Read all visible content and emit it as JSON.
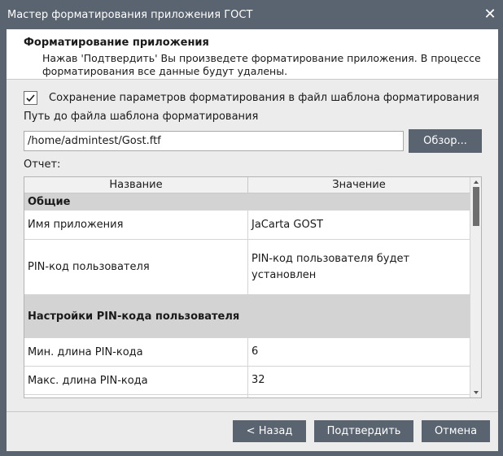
{
  "window": {
    "title": "Мастер форматирования приложения ГОСТ",
    "close_glyph": "✕"
  },
  "header": {
    "title": "Форматирование приложения",
    "description": "Нажав 'Подтвердить' Вы произведете форматирование приложения. В процессе форматирования все данные будут удалены."
  },
  "options": {
    "save_template_checked": true,
    "save_template_label": "Сохранение параметров форматирования в файл шаблона форматирования",
    "path_label": "Путь до файла шаблона форматирования",
    "path_value": "/home/admintest/Gost.ftf",
    "browse_label": "Обзор..."
  },
  "report": {
    "label": "Отчет:",
    "columns": [
      "Название",
      "Значение"
    ],
    "rows": [
      {
        "type": "section",
        "name": "Общие"
      },
      {
        "type": "item",
        "name": "Имя приложения",
        "value": "JaCarta GOST"
      },
      {
        "type": "item",
        "name": "PIN-код пользователя",
        "value": "PIN-код пользователя будет установлен"
      },
      {
        "type": "section",
        "name": "Настройки PIN-кода пользователя"
      },
      {
        "type": "item",
        "name": "Мин. длина PIN-кода",
        "value": "6"
      },
      {
        "type": "item",
        "name": "Макс. длина PIN-кода",
        "value": "32"
      },
      {
        "type": "item",
        "name": "",
        "value": ""
      }
    ]
  },
  "footer": {
    "back_label": "< Назад",
    "confirm_label": "Подтвердить",
    "cancel_label": "Отмена"
  },
  "colors": {
    "accent": "#5a6370",
    "section_row": "#d3d3d3",
    "dialog_bg": "#ececec"
  },
  "icons": {
    "checkbox": "check-icon",
    "close": "close-icon",
    "scroll_up": "chevron-up-icon",
    "scroll_down": "chevron-down-icon"
  }
}
